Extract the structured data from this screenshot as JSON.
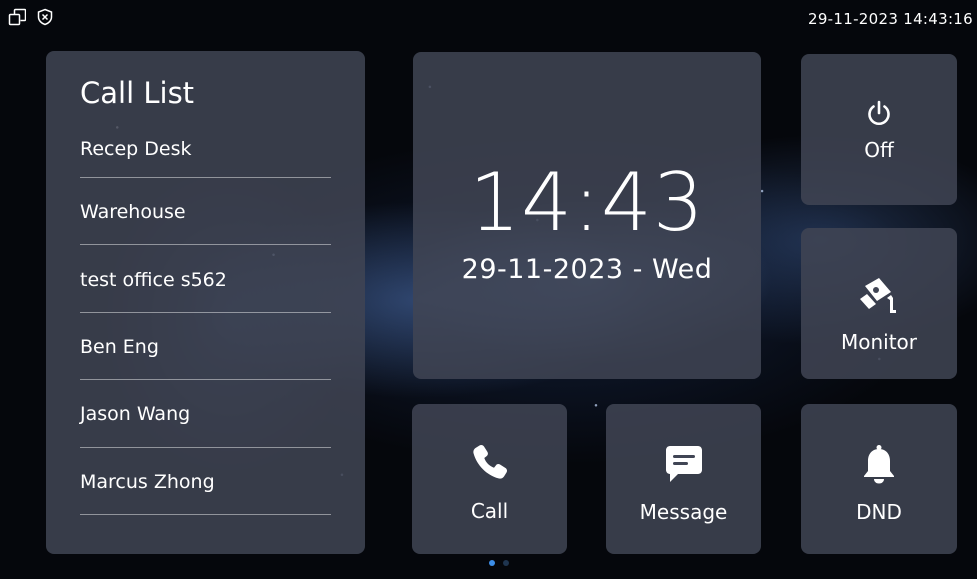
{
  "status_bar": {
    "datetime": "29-11-2023 14:43:16",
    "icons": [
      "window-restore-icon",
      "shield-x-icon"
    ]
  },
  "call_list": {
    "title": "Call List",
    "items": [
      {
        "label": "Recep Desk"
      },
      {
        "label": "Warehouse"
      },
      {
        "label": "test office s562"
      },
      {
        "label": "Ben Eng"
      },
      {
        "label": "Jason Wang"
      },
      {
        "label": "Marcus Zhong"
      }
    ]
  },
  "clock": {
    "time": "14:43",
    "date": "29-11-2023 - Wed"
  },
  "tiles": {
    "off": {
      "label": "Off",
      "icon": "power-icon"
    },
    "monitor": {
      "label": "Monitor",
      "icon": "camera-icon"
    },
    "call": {
      "label": "Call",
      "icon": "phone-icon"
    },
    "message": {
      "label": "Message",
      "icon": "message-icon"
    },
    "dnd": {
      "label": "DND",
      "icon": "bell-icon"
    }
  },
  "pagination": {
    "pages": 2,
    "active": 1
  },
  "colors": {
    "tile_background": "#404554",
    "page_dot_active": "#3d8ee8",
    "page_dot_inactive": "#1f3550",
    "background": "#05070c"
  }
}
